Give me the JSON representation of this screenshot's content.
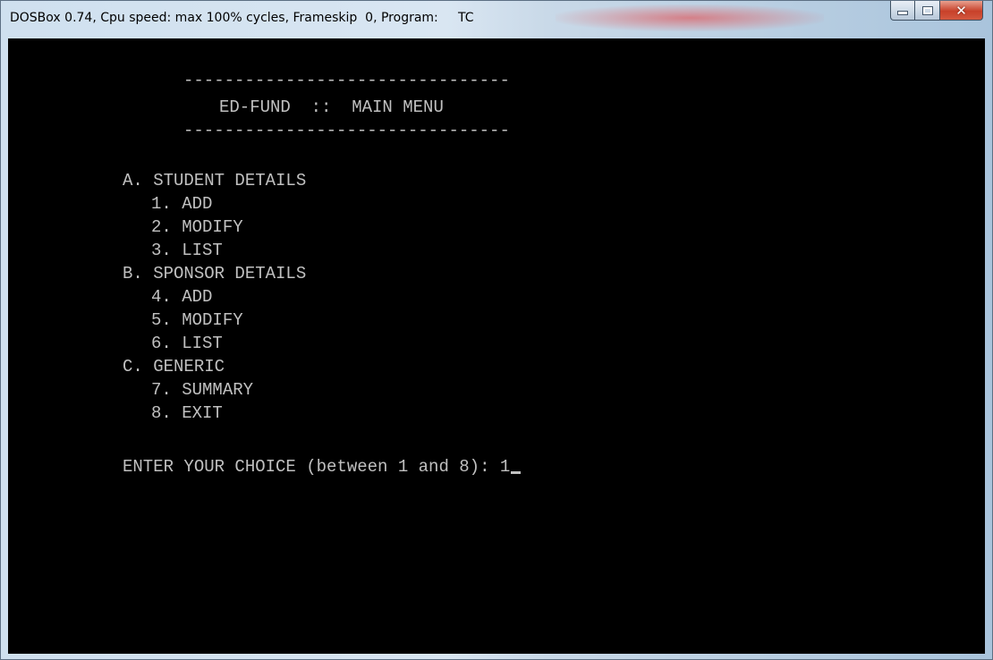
{
  "window": {
    "title": "DOSBox 0.74, Cpu speed: max 100% cycles, Frameskip  0, Program:     TC"
  },
  "menu": {
    "rule_top": "--------------------------------",
    "heading": "ED-FUND  ::  MAIN MENU",
    "rule_bottom": "--------------------------------",
    "sections": [
      {
        "label": "A. STUDENT DETAILS",
        "items": [
          "1. ADD",
          "2. MODIFY",
          "3. LIST"
        ]
      },
      {
        "label": "B. SPONSOR DETAILS",
        "items": [
          "4. ADD",
          "5. MODIFY",
          "6. LIST"
        ]
      },
      {
        "label": "C. GENERIC",
        "items": [
          "7. SUMMARY",
          "8. EXIT"
        ]
      }
    ],
    "prompt": "ENTER YOUR CHOICE (between 1 and 8): ",
    "input_value": "1"
  },
  "icons": {
    "minimize": "minimize-icon",
    "maximize": "maximize-icon",
    "close": "close-icon"
  }
}
